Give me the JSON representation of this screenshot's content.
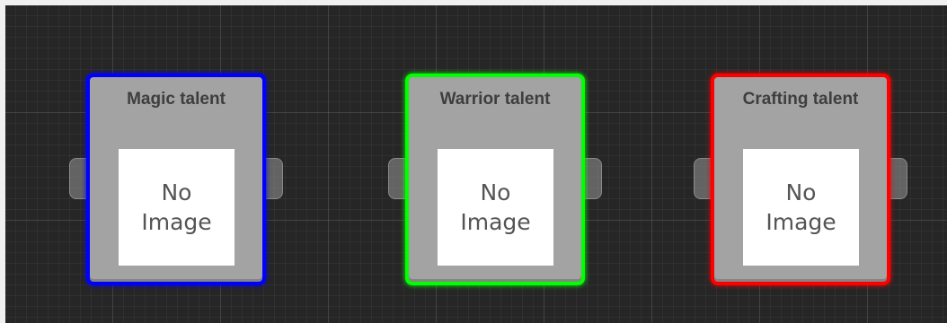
{
  "canvas": {
    "background_color": "#262626"
  },
  "nodes": [
    {
      "title": "Magic talent",
      "border_color": "#0000ff",
      "placeholder_line1": "No",
      "placeholder_line2": "Image"
    },
    {
      "title": "Warrior talent",
      "border_color": "#00ff00",
      "placeholder_line1": "No",
      "placeholder_line2": "Image"
    },
    {
      "title": "Crafting talent",
      "border_color": "#ff0000",
      "placeholder_line1": "No",
      "placeholder_line2": "Image"
    }
  ]
}
